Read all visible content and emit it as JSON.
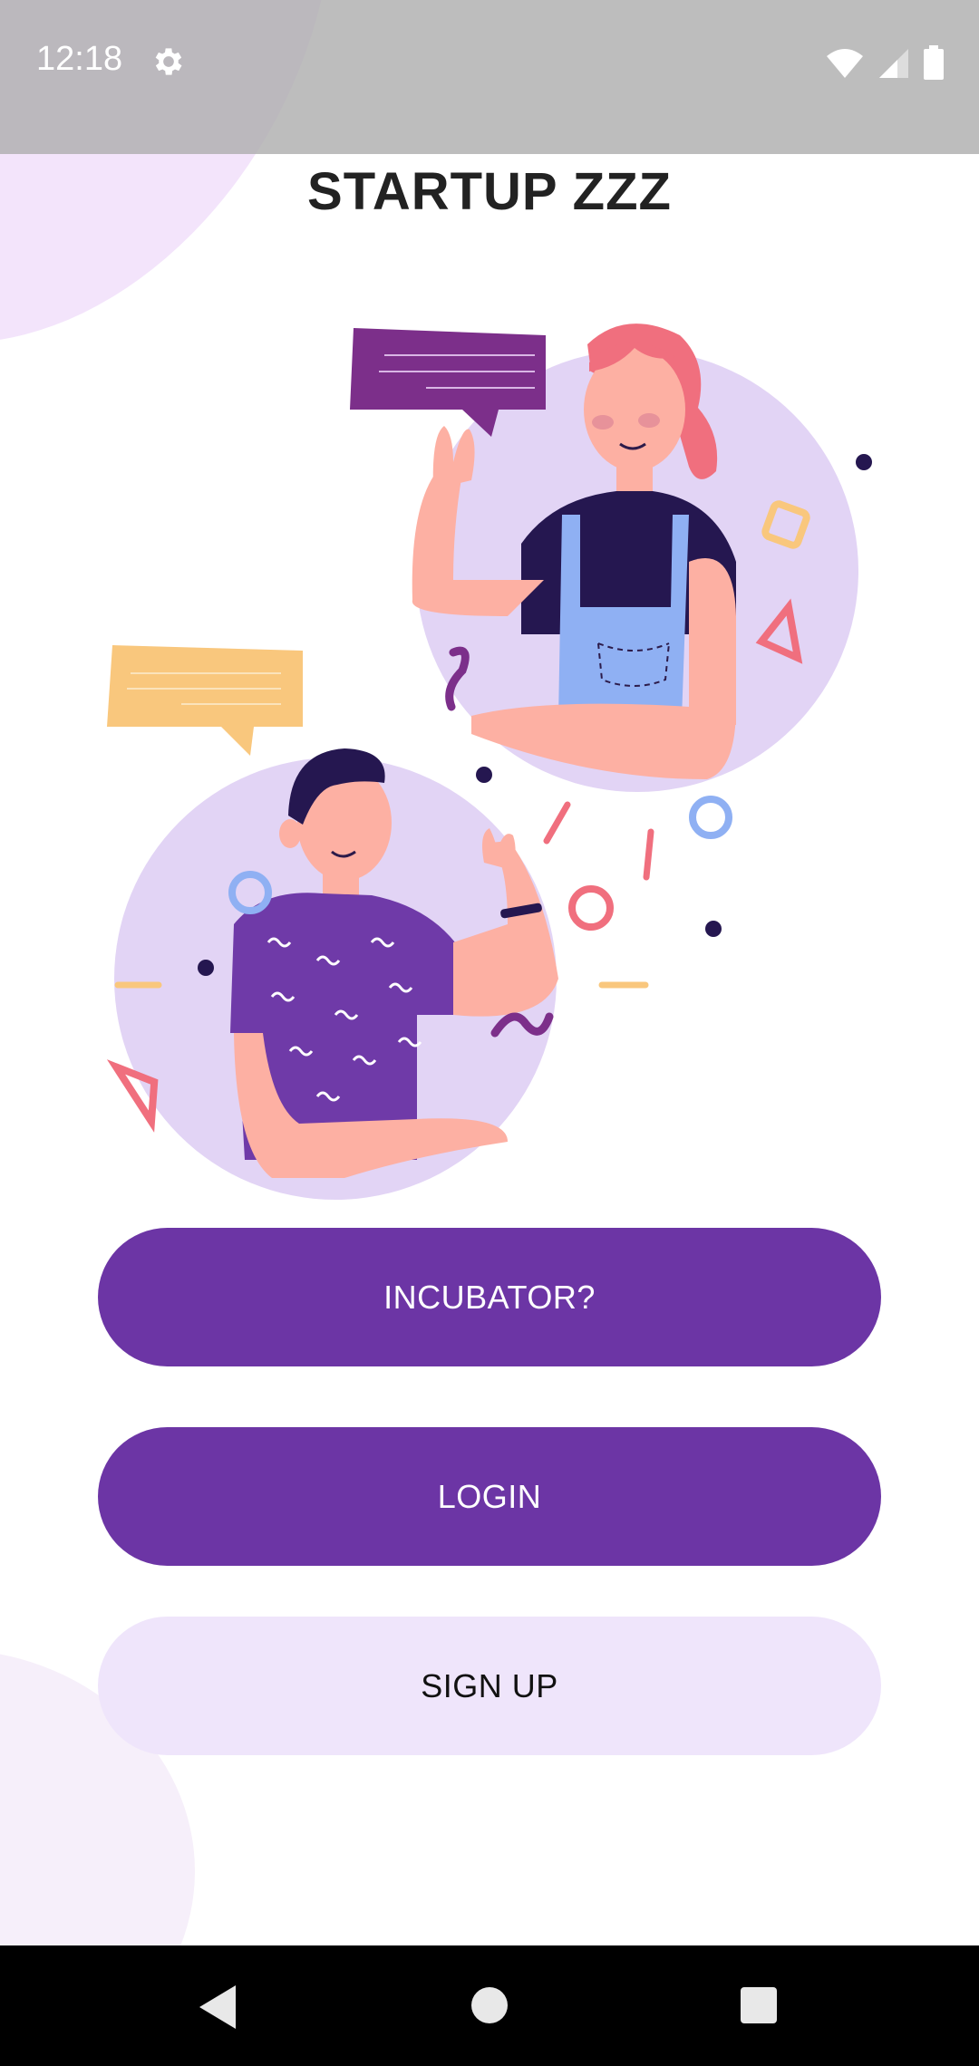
{
  "status_bar": {
    "time": "12:18",
    "icons": [
      "settings-icon",
      "wifi-icon",
      "cellular-signal-icon",
      "battery-icon"
    ]
  },
  "app": {
    "title": "STARTUP ZZZ"
  },
  "buttons": {
    "incubator_label": "INCUBATOR?",
    "login_label": "LOGIN",
    "signup_label": "SIGN UP"
  },
  "navigation": {
    "icons": [
      "back-icon",
      "home-icon",
      "recents-icon"
    ]
  },
  "colors": {
    "primary_button": "#6c35a5",
    "secondary_button": "#efe5fb",
    "title_text": "#222222"
  }
}
